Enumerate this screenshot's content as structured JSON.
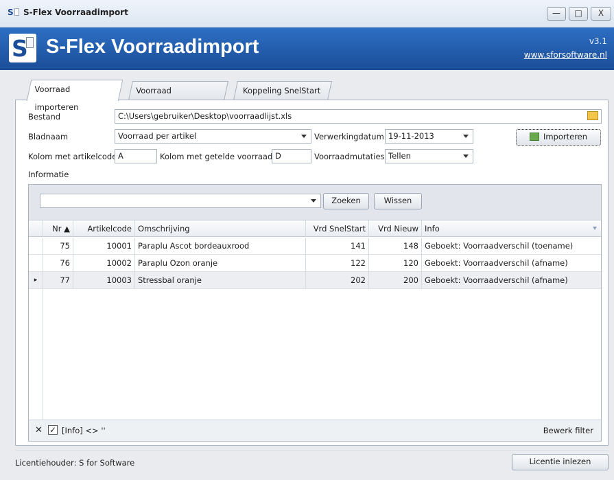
{
  "window": {
    "title": "S-Flex Voorraadimport",
    "app_icon_letter": "S",
    "minimize": "—",
    "maximize": "□",
    "close": "X"
  },
  "banner": {
    "logo_letter": "S",
    "title": "S-Flex Voorraadimport",
    "version": "v3.1",
    "website": "www.sforsoftware.nl",
    "bg_color": "#1b4d98"
  },
  "tabs": [
    {
      "label": "Voorraad importeren",
      "active": true
    },
    {
      "label": "Voorraad exporteren",
      "active": false
    },
    {
      "label": "Koppeling SnelStart",
      "active": false
    }
  ],
  "form": {
    "bestand_label": "Bestand",
    "bestand_value": "C:\\Users\\gebruiker\\Desktop\\voorraadlijst.xls",
    "bladnaam_label": "Bladnaam",
    "bladnaam_value": "Voorraad per artikel",
    "verwerkingsdatum_label": "Verwerkingdatum",
    "verwerkingsdatum_value": "19-11-2013",
    "importeren_label": "Importeren",
    "kolom_artikelcode_label": "Kolom met artikelcode",
    "kolom_artikelcode_value": "A",
    "kolom_voorraad_label": "Kolom met getelde voorraad",
    "kolom_voorraad_value": "D",
    "voorraadmutaties_label": "Voorraadmutaties",
    "voorraadmutaties_value": "Tellen",
    "informatie_label": "Informatie"
  },
  "grid": {
    "search_value": "",
    "zoeken_label": "Zoeken",
    "wissen_label": "Wissen",
    "columns": [
      "Nr ▲",
      "Artikelcode",
      "Omschrijving",
      "Vrd SnelStart",
      "Vrd Nieuw",
      "Info"
    ],
    "rows": [
      {
        "nr": "75",
        "artikelcode": "10001",
        "omschrijving": "Paraplu Ascot bordeauxrood",
        "vrd_snelstart": "141",
        "vrd_nieuw": "148",
        "info": "Geboekt: Voorraadverschil (toename)"
      },
      {
        "nr": "76",
        "artikelcode": "10002",
        "omschrijving": "Paraplu Ozon oranje",
        "vrd_snelstart": "122",
        "vrd_nieuw": "120",
        "info": "Geboekt: Voorraadverschil (afname)"
      },
      {
        "nr": "77",
        "artikelcode": "10003",
        "omschrijving": "Stressbal oranje",
        "vrd_snelstart": "202",
        "vrd_nieuw": "200",
        "info": "Geboekt: Voorraadverschil (afname)"
      }
    ],
    "current_row_marker": "▸",
    "filter_text": "[Info] <> ''",
    "filter_close": "✕",
    "bewerk_filter_label": "Bewerk filter"
  },
  "status": {
    "licentiehouder": "Licentiehouder:  S for Software",
    "licentie_inlezen_label": "Licentie inlezen"
  }
}
